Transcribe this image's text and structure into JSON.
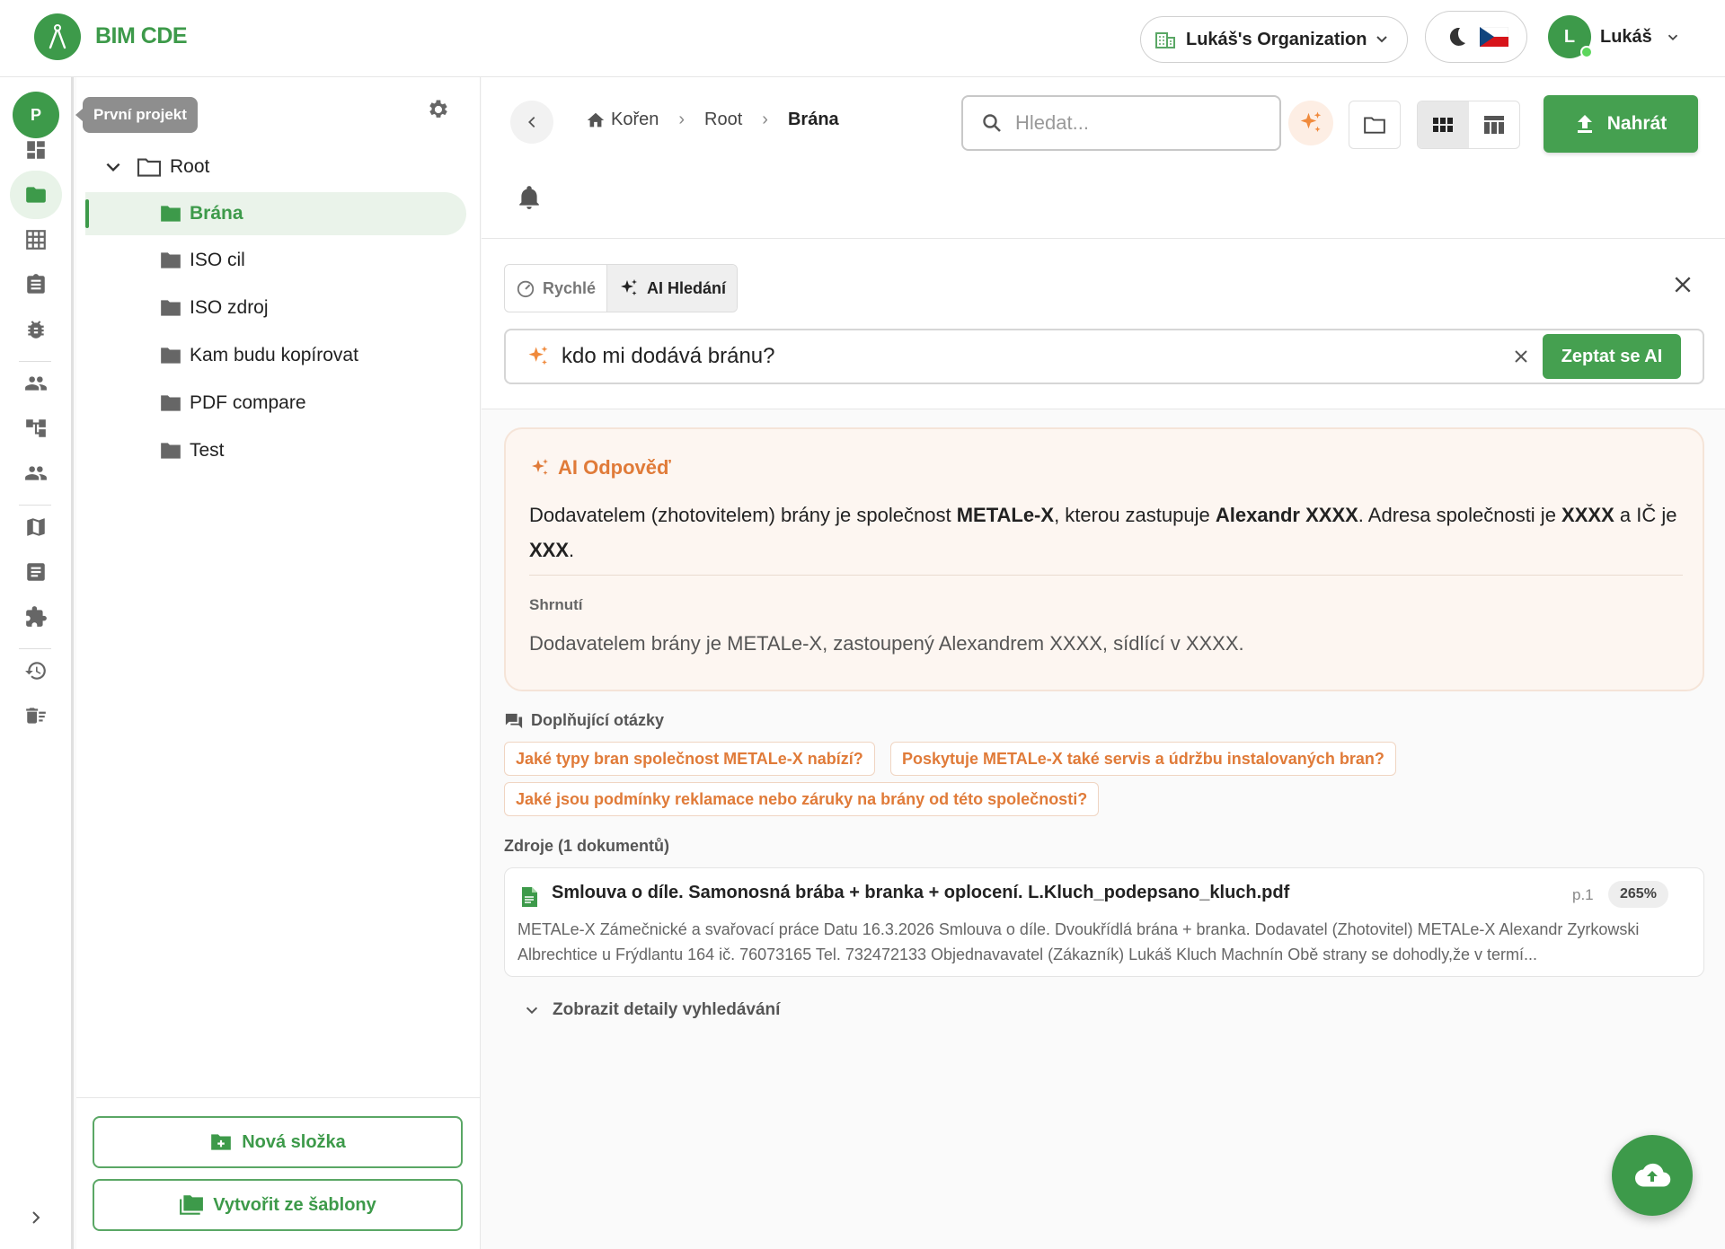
{
  "header": {
    "app_title": "BIM CDE",
    "organization": "Lukáš's Organization",
    "user_initial": "L",
    "user_name": "Lukáš"
  },
  "rail": {
    "project_initial": "P",
    "tooltip": "První projekt",
    "items": [
      "dashboard-icon",
      "folder-icon",
      "grid-icon",
      "clipboard-icon",
      "bug-icon",
      "people-icon",
      "hierarchy-icon",
      "group-icon",
      "map-icon",
      "document-icon",
      "puzzle-icon",
      "history-icon",
      "delete-list-icon"
    ],
    "active": "folder-icon"
  },
  "tree": {
    "root": "Root",
    "folders": [
      "Brána",
      "ISO cil",
      "ISO zdroj",
      "Kam budu kopírovat",
      "PDF compare",
      "Test"
    ],
    "selected": "Brána",
    "new_folder_label": "Nová složka",
    "from_template_label": "Vytvořit ze šablony"
  },
  "breadcrumb": {
    "home": "Kořen",
    "level1": "Root",
    "current": "Brána"
  },
  "search": {
    "placeholder": "Hledat..."
  },
  "toolbar": {
    "upload_label": "Nahrát"
  },
  "ai": {
    "mode_quick": "Rychlé",
    "mode_ai": "AI Hledání",
    "query": "kdo mi dodává bránu?",
    "ask_label": "Zeptat se AI",
    "answer_title": "AI Odpověď",
    "answer_parts": {
      "p1": "Dodavatelem (zhotovitelem) brány je společnost ",
      "b1": "METALe-X",
      "p2": ", kterou zastupuje ",
      "b2": "Alexandr XXXX",
      "p3": ". Adresa společnosti je ",
      "b3": "XXXX",
      "p4": " a IČ je ",
      "b4": "XXX",
      "p5": "."
    },
    "summary_label": "Shrnutí",
    "summary_text": "Dodavatelem brány je METALe-X, zastoupený Alexandrem XXXX, sídlící v XXXX.",
    "followup_label": "Doplňující otázky",
    "followups": [
      "Jaké typy bran společnost METALe-X nabízí?",
      "Poskytuje METALe-X také servis a údržbu instalovaných bran?",
      "Jaké jsou podmínky reklamace nebo záruky na brány od této společnosti?"
    ],
    "sources_label": "Zdroje (1 dokumentů)",
    "source": {
      "filename": "Smlouva o díle. Samonosná brába + branka + oplocení. L.Kluch_podepsano_kluch.pdf",
      "page": "p.1",
      "score": "265%",
      "snippet": "METALe-X Zámečnické a svařovací práce Datu 16.3.2026 Smlouva o díle. Dvoukřídlá brána + branka. Dodavatel (Zhotovitel) METALe-X Alexandr Zyrkowski Albrechtice u Frýdlantu 164 ič. 76073165 Tel. 732472133 Objednavavatel (Zákazník) Lukáš Kluch Machnín Obě strany se dohodly,že v termí..."
    },
    "details_label": "Zobrazit detaily vyhledávání"
  },
  "colors": {
    "brand": "#3d9a4a",
    "ai_accent": "#e07b39"
  }
}
